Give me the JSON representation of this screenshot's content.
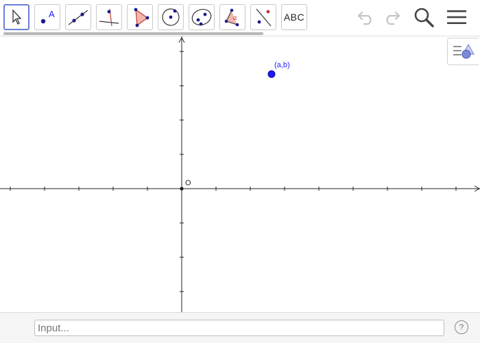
{
  "toolbar": {
    "tools": [
      {
        "name": "move-tool",
        "icon": "pointer-arrow-icon",
        "selected": true
      },
      {
        "name": "point-tool",
        "icon": "point-with-label-icon",
        "label": "A"
      },
      {
        "name": "line-tool",
        "icon": "line-through-points-icon"
      },
      {
        "name": "perpendicular-line-tool",
        "icon": "perpendicular-line-icon"
      },
      {
        "name": "polygon-tool",
        "icon": "triangle-polygon-icon"
      },
      {
        "name": "circle-tool",
        "icon": "circle-center-point-icon"
      },
      {
        "name": "conic-tool",
        "icon": "ellipse-icon"
      },
      {
        "name": "angle-tool",
        "icon": "angle-icon",
        "label": "α"
      },
      {
        "name": "reflect-tool",
        "icon": "reflect-about-line-icon"
      },
      {
        "name": "text-tool",
        "icon": "text-icon",
        "label": "ABC"
      }
    ],
    "undo_icon": "undo-icon",
    "redo_icon": "redo-icon",
    "search_icon": "search-icon",
    "menu_icon": "menu-icon"
  },
  "graphics": {
    "origin_label": "O",
    "point_label": "(a,b)",
    "point_color": "#1a1aff",
    "style_bar_icon": "style-bar-toggle-icon"
  },
  "input_bar": {
    "placeholder": "Input...",
    "help_label": "?"
  }
}
